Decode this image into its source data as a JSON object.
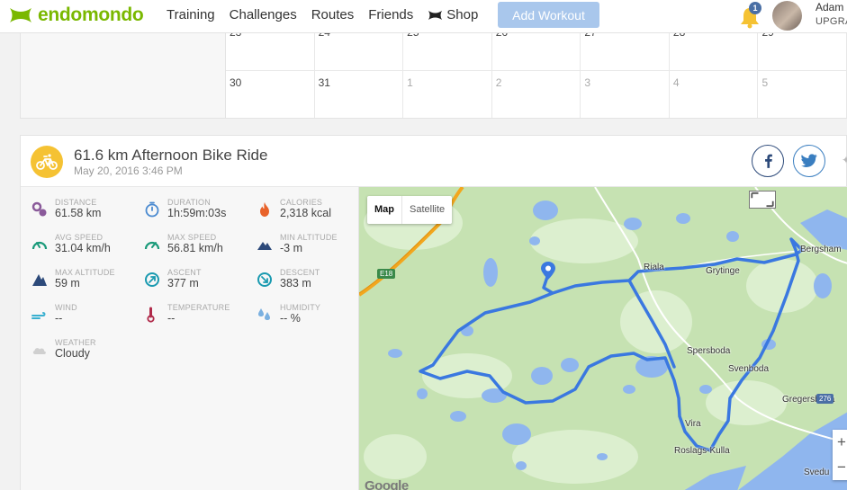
{
  "brand": {
    "name": "endomondo",
    "color": "#7ab800"
  },
  "nav": {
    "items": [
      "Training",
      "Challenges",
      "Routes",
      "Friends"
    ],
    "shop": "Shop"
  },
  "add_workout": "Add Workout",
  "notifications": {
    "count": "1"
  },
  "user": {
    "name": "Adam",
    "plan": "UPGRA"
  },
  "calendar": {
    "row1": [
      "23",
      "24",
      "25",
      "26",
      "27",
      "28",
      "29"
    ],
    "row2": [
      "30",
      "31",
      "1",
      "2",
      "3",
      "4",
      "5"
    ]
  },
  "workout": {
    "title": "61.6 km Afternoon Bike Ride",
    "date": "May 20, 2016 3:46 PM",
    "sport_icon": "bike-icon",
    "stats": {
      "distance": {
        "label": "DISTANCE",
        "value": "61.58 km",
        "icon": "distance-icon",
        "color": "#8a5a9a"
      },
      "duration": {
        "label": "DURATION",
        "value": "1h:59m:03s",
        "icon": "stopwatch-icon",
        "color": "#4a8ad0"
      },
      "calories": {
        "label": "CALORIES",
        "value": "2,318 kcal",
        "icon": "flame-icon",
        "color": "#e8622a"
      },
      "avg_speed": {
        "label": "AVG SPEED",
        "value": "31.04 km/h",
        "icon": "speedometer-icon",
        "color": "#1a9a7a"
      },
      "max_speed": {
        "label": "MAX SPEED",
        "value": "56.81 km/h",
        "icon": "speedometer-icon",
        "color": "#1a9a7a"
      },
      "min_altitude": {
        "label": "MIN ALTITUDE",
        "value": "-3 m",
        "icon": "mountain-icon",
        "color": "#2d4a7a"
      },
      "max_altitude": {
        "label": "MAX ALTITUDE",
        "value": "59 m",
        "icon": "mountain-icon",
        "color": "#2d4a7a"
      },
      "ascent": {
        "label": "ASCENT",
        "value": "377 m",
        "icon": "ascent-icon",
        "color": "#1a9ab0"
      },
      "descent": {
        "label": "DESCENT",
        "value": "383 m",
        "icon": "descent-icon",
        "color": "#1a9ab0"
      },
      "wind": {
        "label": "WIND",
        "value": "--",
        "icon": "wind-icon",
        "color": "#3ab0d0"
      },
      "temperature": {
        "label": "TEMPERATURE",
        "value": "--",
        "icon": "thermometer-icon",
        "color": "#b02a4a"
      },
      "humidity": {
        "label": "HUMIDITY",
        "value": "-- %",
        "icon": "humidity-icon",
        "color": "#7ab0e0"
      },
      "weather": {
        "label": "WEATHER",
        "value": "Cloudy",
        "icon": "cloud-icon",
        "color": "#ccc"
      }
    }
  },
  "map": {
    "tabs": [
      "Map",
      "Satellite"
    ],
    "active_tab": "Map",
    "labels": [
      "Riala",
      "Grytinge",
      "Bergsham",
      "Spersboda",
      "Svenboda",
      "Vira",
      "Roslags-Kulla",
      "Gregersboda",
      "Svedu"
    ],
    "roads": [
      "E18",
      "276"
    ],
    "zoom_in": "+",
    "zoom_out": "−",
    "attribution": "Google",
    "route_color": "#3a78e0"
  }
}
